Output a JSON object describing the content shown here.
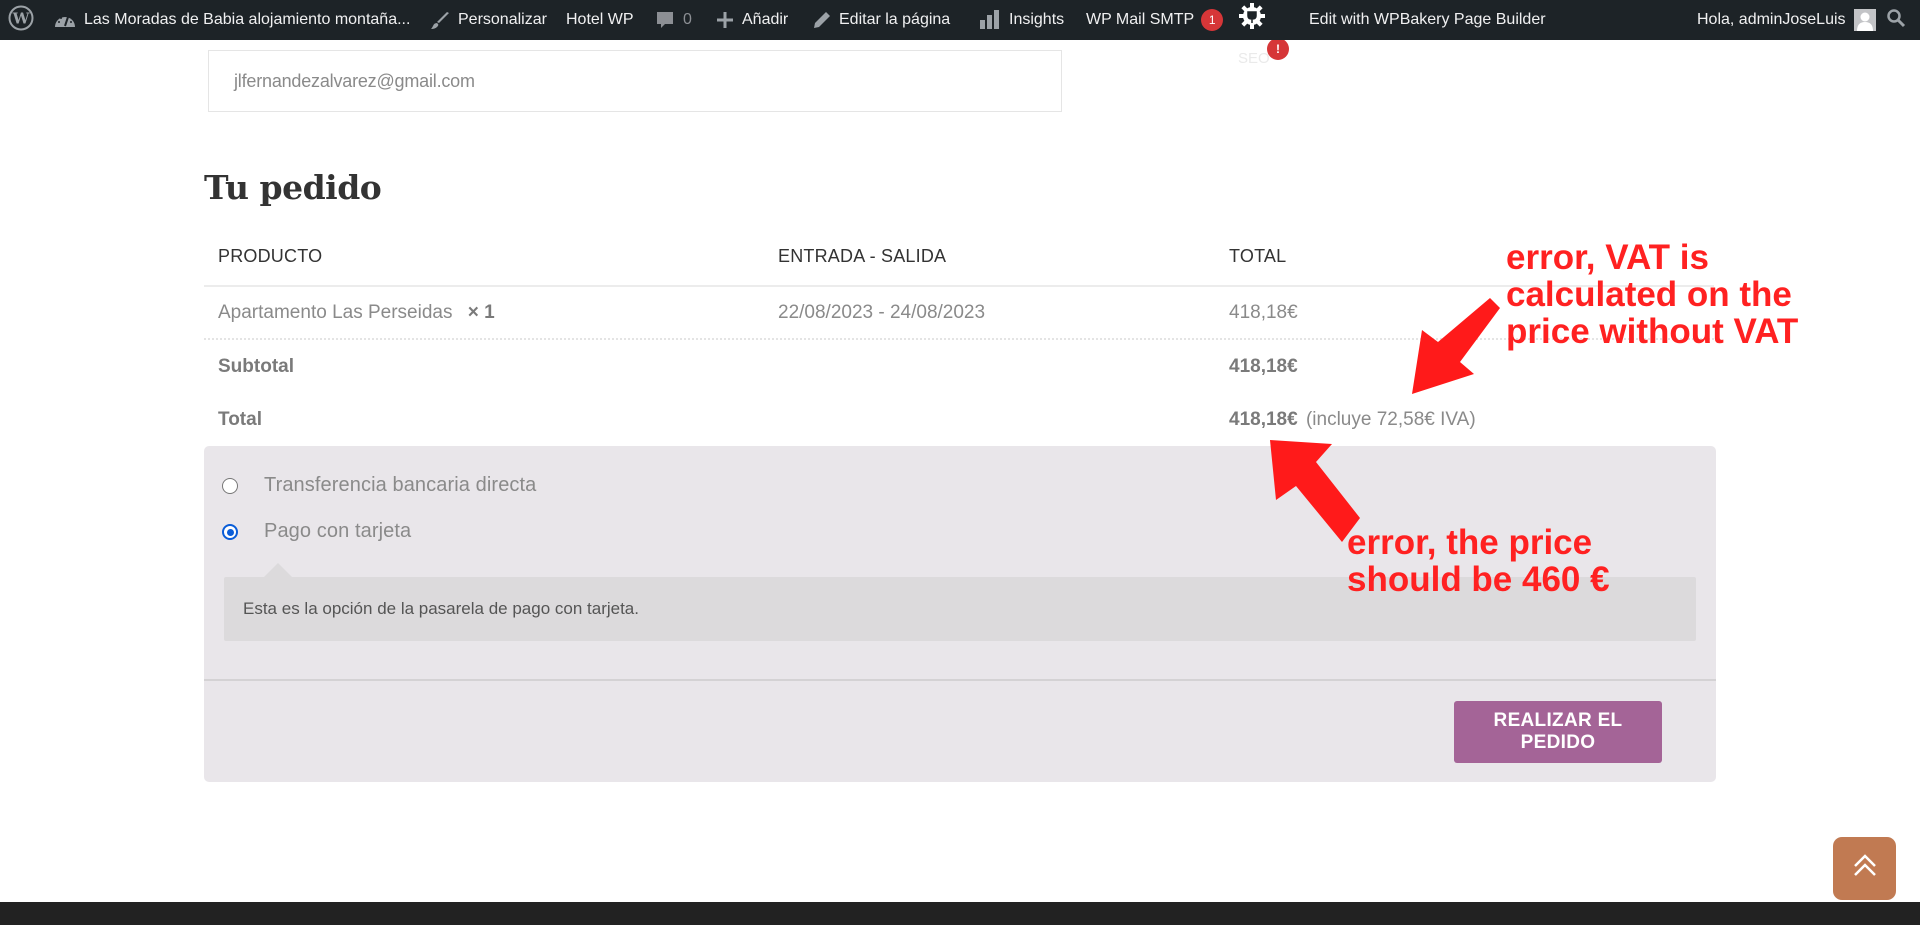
{
  "admin_bar": {
    "wp_logo": "wordpress-icon",
    "site_name": "Las Moradas de Babia alojamiento montaña...",
    "customize": "Personalizar",
    "theme_item": "Hotel WP",
    "comments_count": "0",
    "new_item": "Añadir",
    "edit_page": "Editar la página",
    "insights": "Insights",
    "wp_mail_smtp": "WP Mail SMTP",
    "wp_mail_smtp_badge": "1",
    "seo_label": "SEO",
    "seo_badge": "!",
    "wpbakery": "Edit with WPBakery Page Builder",
    "greeting": "Hola, adminJoseLuis"
  },
  "checkout": {
    "email_value": "jlfernandezalvarez@gmail.com",
    "order_title": "Tu pedido",
    "table": {
      "headers": [
        "PRODUCTO",
        "ENTRADA - SALIDA",
        "TOTAL"
      ],
      "rows": [
        {
          "product": "Apartamento Las Perseidas",
          "quantity": "× 1",
          "dates": "22/08/2023 - 24/08/2023",
          "total": "418,18€"
        }
      ],
      "subtotal_label": "Subtotal",
      "subtotal_value": "418,18€",
      "total_label": "Total",
      "total_value": "418,18€",
      "total_tax_note": "(incluye 72,58€ IVA)"
    },
    "payment": {
      "methods": [
        {
          "label": "Transferencia bancaria directa",
          "selected": false
        },
        {
          "label": "Pago con tarjeta",
          "selected": true
        }
      ],
      "selected_description": "Esta es la opción de la pasarela de pago con tarjeta.",
      "place_order_label": "REALIZAR EL PEDIDO",
      "place_order_color": "#a46497"
    }
  },
  "annotations": {
    "vat_error_lines": [
      "error, VAT is",
      "calculated on the",
      "price without VAT"
    ],
    "price_error_lines": [
      "error, the price",
      "should be 460 €"
    ],
    "color": "#ff2121"
  },
  "back_to_top_color": "#c17a52"
}
